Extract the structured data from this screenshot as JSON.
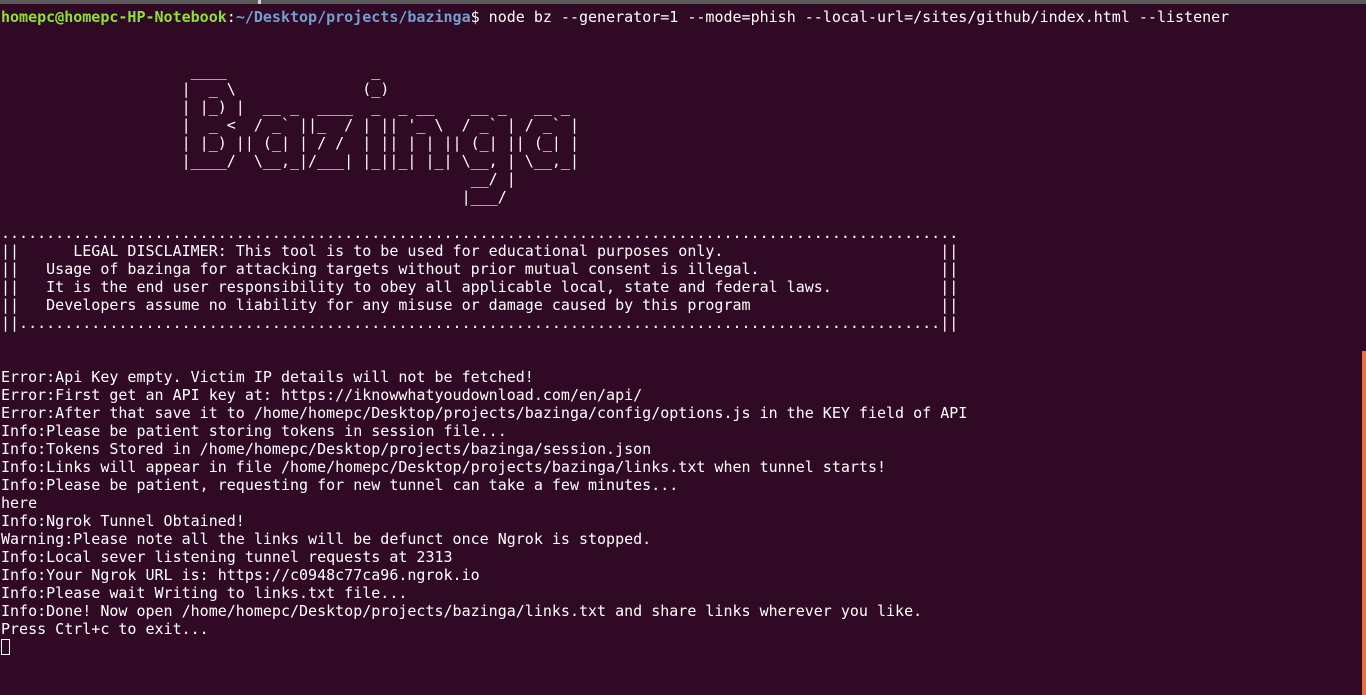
{
  "prompt": {
    "user_host": "homepc@homepc-HP-Notebook",
    "separator": ":",
    "path": "~/Desktop/projects/bazinga",
    "symbol": "$",
    "command": " node bz --generator=1 --mode=phish --local-url=/sites/github/index.html --listener"
  },
  "banner": [
    "                     ____                _",
    "                    |  _ \\              (_)",
    "                    | |_) |  __ _  ____  _  _ __    __ _   __ _",
    "                    |  _ <  / _` ||_  / | || '_ \\  / _` | / _` |",
    "                    | |_) || (_| | / /  | || | | || (_| || (_| |",
    "                    |____/  \\__,_|/___| |_||_| |_| \\__, | \\__,_|",
    "                                                    __/ |",
    "                                                   |___/"
  ],
  "disclaimer": [
    "..........................................................................................................",
    "||      LEGAL DISCLAIMER: This tool is to be used for educational purposes only.                        ||",
    "||   Usage of bazinga for attacking targets without prior mutual consent is illegal.                    ||",
    "||   It is the end user responsibility to obey all applicable local, state and federal laws.            ||",
    "||   Developers assume no liability for any misuse or damage caused by this program                     ||",
    "||......................................................................................................||"
  ],
  "log": [
    "Error:Api Key empty. Victim IP details will not be fetched!",
    "Error:First get an API key at: https://iknowwhatyoudownload.com/en/api/",
    "Error:After that save it to /home/homepc/Desktop/projects/bazinga/config/options.js in the KEY field of API",
    "Info:Please be patient storing tokens in session file...",
    "Info:Tokens Stored in /home/homepc/Desktop/projects/bazinga/session.json",
    "Info:Links will appear in file /home/homepc/Desktop/projects/bazinga/links.txt when tunnel starts!",
    "Info:Please be patient, requesting for new tunnel can take a few minutes...",
    "here",
    "Info:Ngrok Tunnel Obtained!",
    "Warning:Please note all the links will be defunct once Ngrok is stopped.",
    "Info:Local sever listening tunnel requests at 2313",
    "Info:Your Ngrok URL is: https://c0948c77ca96.ngrok.io",
    "Info:Please wait Writing to links.txt file...",
    "Info:Done! Now open /home/homepc/Desktop/projects/bazinga/links.txt and share links wherever you like.",
    "Press Ctrl+c to exit..."
  ]
}
